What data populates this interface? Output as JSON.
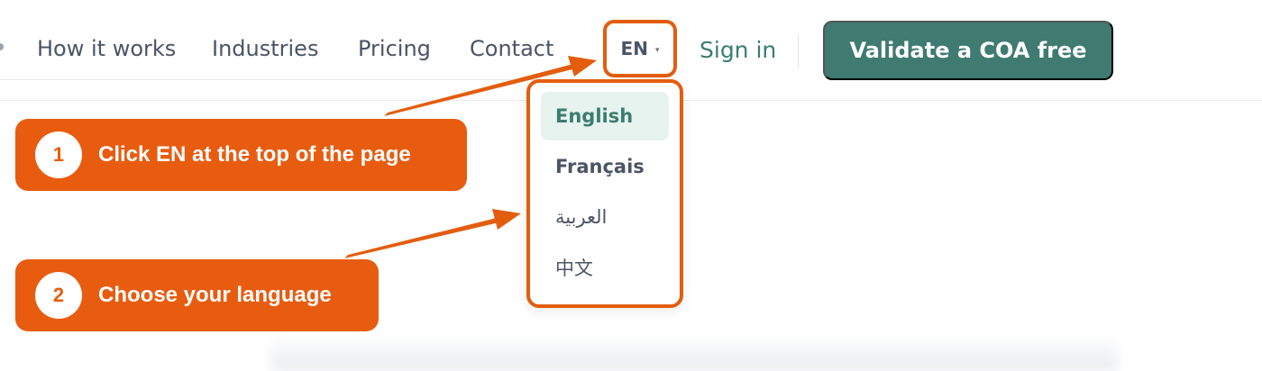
{
  "nav": {
    "links": [
      "How it works",
      "Industries",
      "Pricing",
      "Contact"
    ],
    "language_code": "EN",
    "language_chevron": "▾",
    "sign_in": "Sign in",
    "cta": "Validate a COA free"
  },
  "language_menu": {
    "options": [
      "English",
      "Français",
      "العربية",
      "中文"
    ],
    "selected": "English"
  },
  "steps": [
    {
      "number": "1",
      "text": "Click EN at the top of the page"
    },
    {
      "number": "2",
      "text": "Choose your language"
    }
  ],
  "colors": {
    "accent_orange": "#e85c10",
    "brand_green": "#3f7b70",
    "selected_bg": "#e7f3ef",
    "nav_text": "#4a5565"
  }
}
